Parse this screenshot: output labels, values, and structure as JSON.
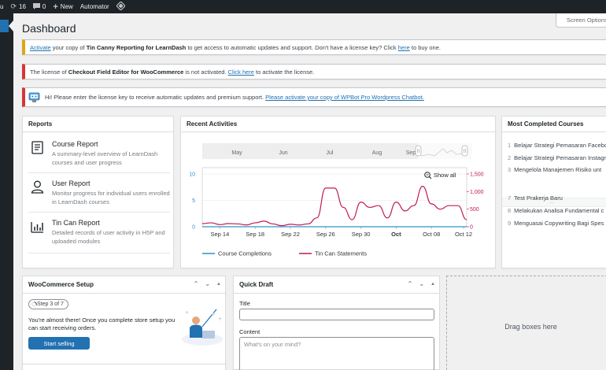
{
  "adminbar": {
    "left_fragment": "u",
    "updates_count": "16",
    "comments_count": "0",
    "new_label": "New",
    "automator_label": "Automator"
  },
  "screen_options": "Screen Options",
  "page_title": "Dashboard",
  "notices": {
    "n1": {
      "link1": "Activate",
      "text1": " your copy of ",
      "bold": "Tin Canny Reporting for LearnDash",
      "text2": " to get access to automatic updates and support. Don't have a license key? Click ",
      "link2": "here",
      "text3": " to buy one."
    },
    "n2": {
      "text1": "The license of ",
      "bold": "Checkout Field Editor for WooCommerce",
      "text2": " is not activated. ",
      "link": "Click here",
      "text3": " to activate the license."
    },
    "n3": {
      "text1": "Hi! Please enter the license key to receive automatic updates and premium support. ",
      "link": "Please activate your copy of WPBot Pro Wordpress Chatbot."
    }
  },
  "reports": {
    "title": "Reports",
    "items": [
      {
        "title": "Course Report",
        "desc": "A summary-level overview of LearnDash courses and user progress"
      },
      {
        "title": "User Report",
        "desc": "Monitor progress for individual users enrolled in LearnDash courses"
      },
      {
        "title": "Tin Can Report",
        "desc": "Detailed records of user activity in H5P and uploaded modules"
      }
    ]
  },
  "activities": {
    "title": "Recent Activities",
    "show_all": "Show all"
  },
  "chart_data": {
    "type": "line",
    "navigator_months": [
      "May",
      "Jun",
      "Jul",
      "Aug",
      "Sep"
    ],
    "x_ticks": [
      "Sep 14",
      "Sep 18",
      "Sep 22",
      "Sep 26",
      "Sep 30",
      "Oct",
      "Oct 08",
      "Oct 12"
    ],
    "y_left_ticks": [
      0,
      5,
      10
    ],
    "y_right_ticks": [
      0,
      500,
      1000,
      1500
    ],
    "series": [
      {
        "name": "Course Completions",
        "color": "#2e93c7",
        "axis": "left",
        "x": [
          0,
          3,
          6,
          9,
          12,
          15,
          18,
          21,
          24,
          27,
          30
        ],
        "values": [
          0,
          0,
          0,
          0,
          0,
          0,
          0,
          0,
          0,
          0,
          0
        ]
      },
      {
        "name": "Tin Can Statements",
        "color": "#c2185b",
        "axis": "right",
        "x": [
          0,
          1,
          2,
          3,
          4,
          5,
          6,
          7,
          8,
          9,
          10,
          11,
          12,
          13,
          14,
          15,
          16,
          17,
          18,
          19,
          20,
          21,
          22,
          23,
          24,
          25,
          26,
          27,
          28,
          29,
          30
        ],
        "values": [
          90,
          110,
          60,
          90,
          80,
          50,
          110,
          160,
          80,
          30,
          70,
          50,
          80,
          250,
          1100,
          1100,
          550,
          200,
          700,
          550,
          600,
          250,
          700,
          450,
          600,
          1150,
          650,
          500,
          600,
          600,
          200
        ]
      }
    ],
    "legend": "bottom"
  },
  "completed": {
    "title": "Most Completed Courses",
    "items_top": [
      {
        "num": "1",
        "name": "Belajar Strategi Pemasaran Facebo"
      },
      {
        "num": "2",
        "name": "Belajar Strategi Pemasaran Instagra"
      },
      {
        "num": "3",
        "name": "Mengelola Manajemen Risiko unt"
      }
    ],
    "more": "...",
    "items_bottom": [
      {
        "num": "7",
        "name": "Test Prakerja Baru"
      },
      {
        "num": "8",
        "name": "Melakukan Analisa Fundamental c"
      },
      {
        "num": "9",
        "name": "Menguasai Copywriting Bagi Spes"
      }
    ]
  },
  "woo": {
    "title": "WooCommerce Setup",
    "step": "Step 3 of 7",
    "text": "You're almost there! Once you complete store setup you can start receiving orders.",
    "button": "Start selling"
  },
  "draft": {
    "title": "Quick Draft",
    "title_label": "Title",
    "content_label": "Content",
    "content_placeholder": "What's on your mind?"
  },
  "dropzone": "Drag boxes here"
}
